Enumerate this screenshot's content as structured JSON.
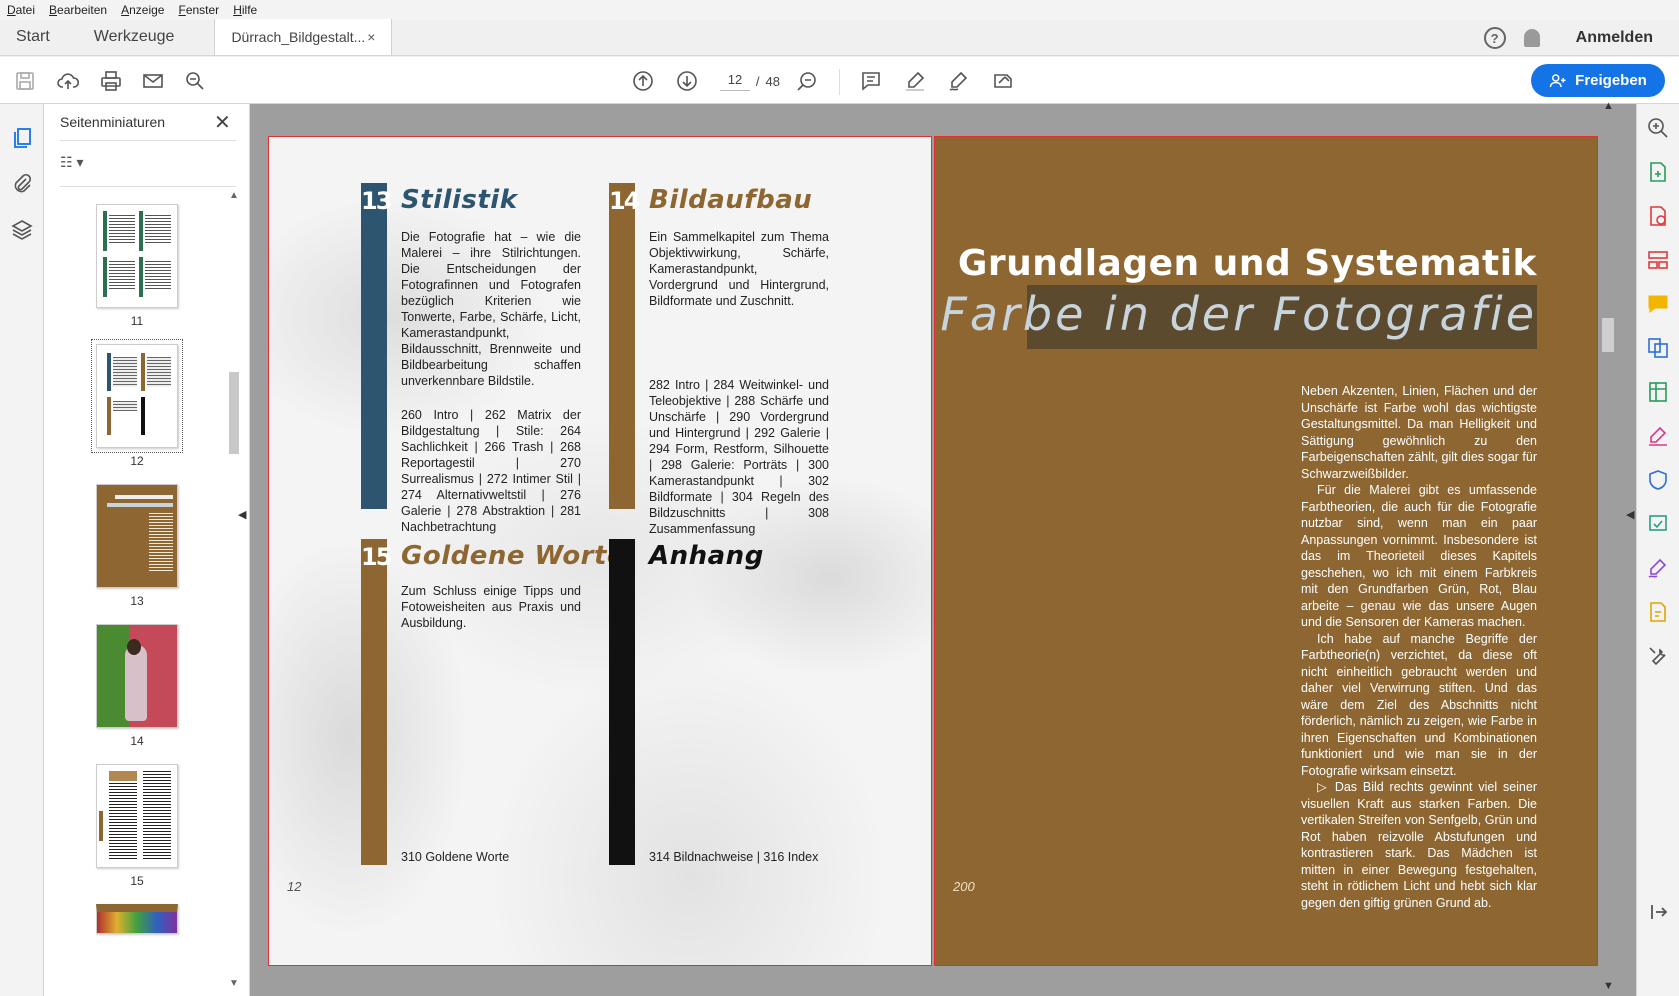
{
  "menu": [
    "Datei",
    "Bearbeiten",
    "Anzeige",
    "Fenster",
    "Hilfe"
  ],
  "tabs": {
    "start": "Start",
    "tools": "Werkzeuge",
    "doc": "Dürrach_Bildgestalt...",
    "close": "×"
  },
  "header": {
    "signin": "Anmelden",
    "help": "?"
  },
  "toolbar": {
    "page_current": "12",
    "page_sep": "/",
    "page_total": "48",
    "share_label": "Freigeben"
  },
  "thumbs": {
    "title": "Seitenminiaturen",
    "close": "✕",
    "options": "☷ ▾",
    "pages": [
      "11",
      "12",
      "13",
      "14",
      "15"
    ]
  },
  "left_page": {
    "page_number": "12",
    "chapters": [
      {
        "num": "13",
        "title": "Stilistik",
        "text": "Die Fotografie hat – wie die Malerei – ihre Stilrichtungen. Die Entscheidungen der Fotografinnen und Fotografen bezüglich Kriterien wie Tonwerte, Farbe, Schärfe, Licht, Kamerastandpunkt, Bildausschnitt, Brennweite und Bildbearbeitung schaffen unverkennbare Bildstile.",
        "pages": "260 Intro | 262 Matrix der Bildgestaltung | Stile: 264 Sachlichkeit | 266 Trash | 268 Reportagestil | 270 Surrealismus | 272 Intimer Stil | 274 Alternativweltstil | 276 Galerie | 278 Abstraktion | 281 Nachbetrachtung"
      },
      {
        "num": "14",
        "title": "Bildaufbau",
        "text": "Ein Sammelkapitel zum Thema Objektivwirkung, Schärfe, Kamerastandpunkt, Vordergrund und Hintergrund, Bildformate und Zuschnitt.",
        "pages": "282 Intro | 284 Weitwinkel- und Teleobjektive | 288 Schärfe und Unschärfe | 290 Vordergrund und Hintergrund | 292 Galerie | 294 Form, Restform, Silhouette | 298 Galerie: Porträts | 300 Kamerastandpunkt | 302 Bildformate | 304 Regeln des Bildzuschnitts | 308 Zusammenfassung"
      },
      {
        "num": "15",
        "title": "Goldene Worte",
        "text": "Zum Schluss einige Tipps und Fotoweisheiten aus Praxis und Ausbildung.",
        "pages": "310 Goldene Worte"
      },
      {
        "num": "",
        "title": "Anhang",
        "text": "",
        "pages": "314 Bildnachweise | 316 Index"
      }
    ]
  },
  "right_page": {
    "page_number": "200",
    "heading": "Grundlagen und Systematik",
    "subheading": "Farbe in der Fotografie",
    "paragraphs": [
      "Neben Akzenten, Linien, Flächen und der Unschärfe ist Farbe wohl das wichtigste Gestaltungsmittel. Da man Helligkeit und Sättigung gewöhnlich zu den Farbeigenschaften zählt, gilt dies sogar für Schwarzweißbilder.",
      "Für die Malerei gibt es umfassende Farbtheorien, die auch für die Fotografie nutzbar sind, wenn man ein paar Anpassungen vornimmt. Insbesondere ist das im Theorieteil dieses Kapitels geschehen, wo ich mit einem Farbkreis mit den Grundfarben Grün, Rot, Blau arbeite – genau wie das unsere Augen und die Sensoren der Kameras machen.",
      "Ich habe auf manche Begriffe der Farbtheorie(n) verzichtet, da diese oft nicht einheitlich gebraucht werden und daher viel Verwirrung stiften. Und das wäre dem Ziel des Abschnitts nicht förderlich, nämlich zu zeigen, wie Farbe in ihren Eigenschaften und Kombinationen funktioniert und wie man sie in der Fotografie wirksam einsetzt.",
      "▷ Das Bild rechts gewinnt viel seiner visuellen Kraft aus starken Farben. Die vertikalen Streifen von Senfgelb, Grün und Rot haben reizvolle Abstufungen und kontrastieren stark. Das Mädchen ist mitten in einer Bewegung festgehalten, steht in rötlichem Licht und hebt sich klar gegen den giftig grünen Grund ab."
    ]
  },
  "colors": {
    "accent_blue": "#1473e6",
    "chapter_blue": "#2d5570",
    "chapter_brown": "#8d6631",
    "page_brown": "#8d6631",
    "highlight": "#5b4a2e"
  }
}
